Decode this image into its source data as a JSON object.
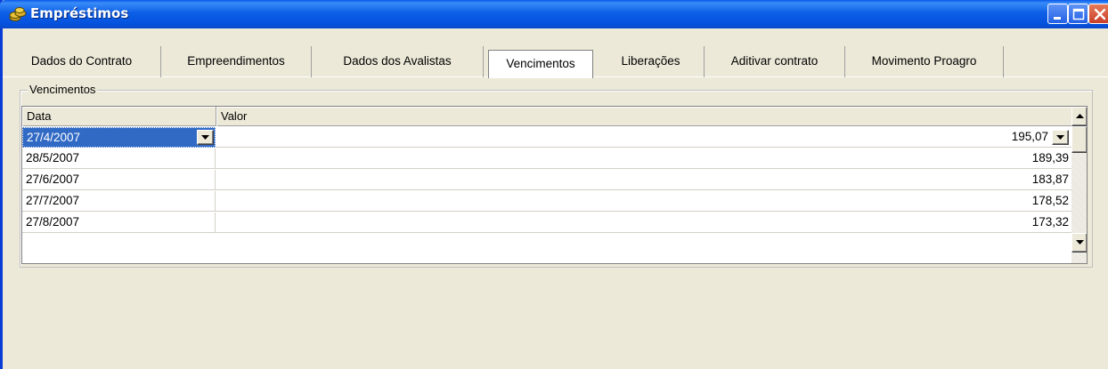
{
  "window": {
    "title": "Empréstimos",
    "icon": "coins-icon",
    "controls": [
      "minimize",
      "maximize",
      "close"
    ]
  },
  "tabs": [
    {
      "label": "Dados do Contrato",
      "active": false
    },
    {
      "label": "Empreendimentos",
      "active": false
    },
    {
      "label": "Dados dos Avalistas",
      "active": false
    },
    {
      "label": "Vencimentos",
      "active": true
    },
    {
      "label": "Liberações",
      "active": false
    },
    {
      "label": "Aditivar contrato",
      "active": false
    },
    {
      "label": "Movimento Proagro",
      "active": false
    }
  ],
  "group": {
    "label": "Vencimentos"
  },
  "grid": {
    "columns": [
      "Data",
      "Valor"
    ],
    "rows": [
      {
        "date": "27/4/2007",
        "value": "195,07",
        "selected": true
      },
      {
        "date": "28/5/2007",
        "value": "189,39",
        "selected": false
      },
      {
        "date": "27/6/2007",
        "value": "183,87",
        "selected": false
      },
      {
        "date": "27/7/2007",
        "value": "178,52",
        "selected": false
      },
      {
        "date": "27/8/2007",
        "value": "173,32",
        "selected": false
      }
    ]
  },
  "colors": {
    "titlebar": "#0551dd",
    "window_bg": "#ece9d8",
    "selection": "#316ac5",
    "close_button": "#c8402a"
  }
}
